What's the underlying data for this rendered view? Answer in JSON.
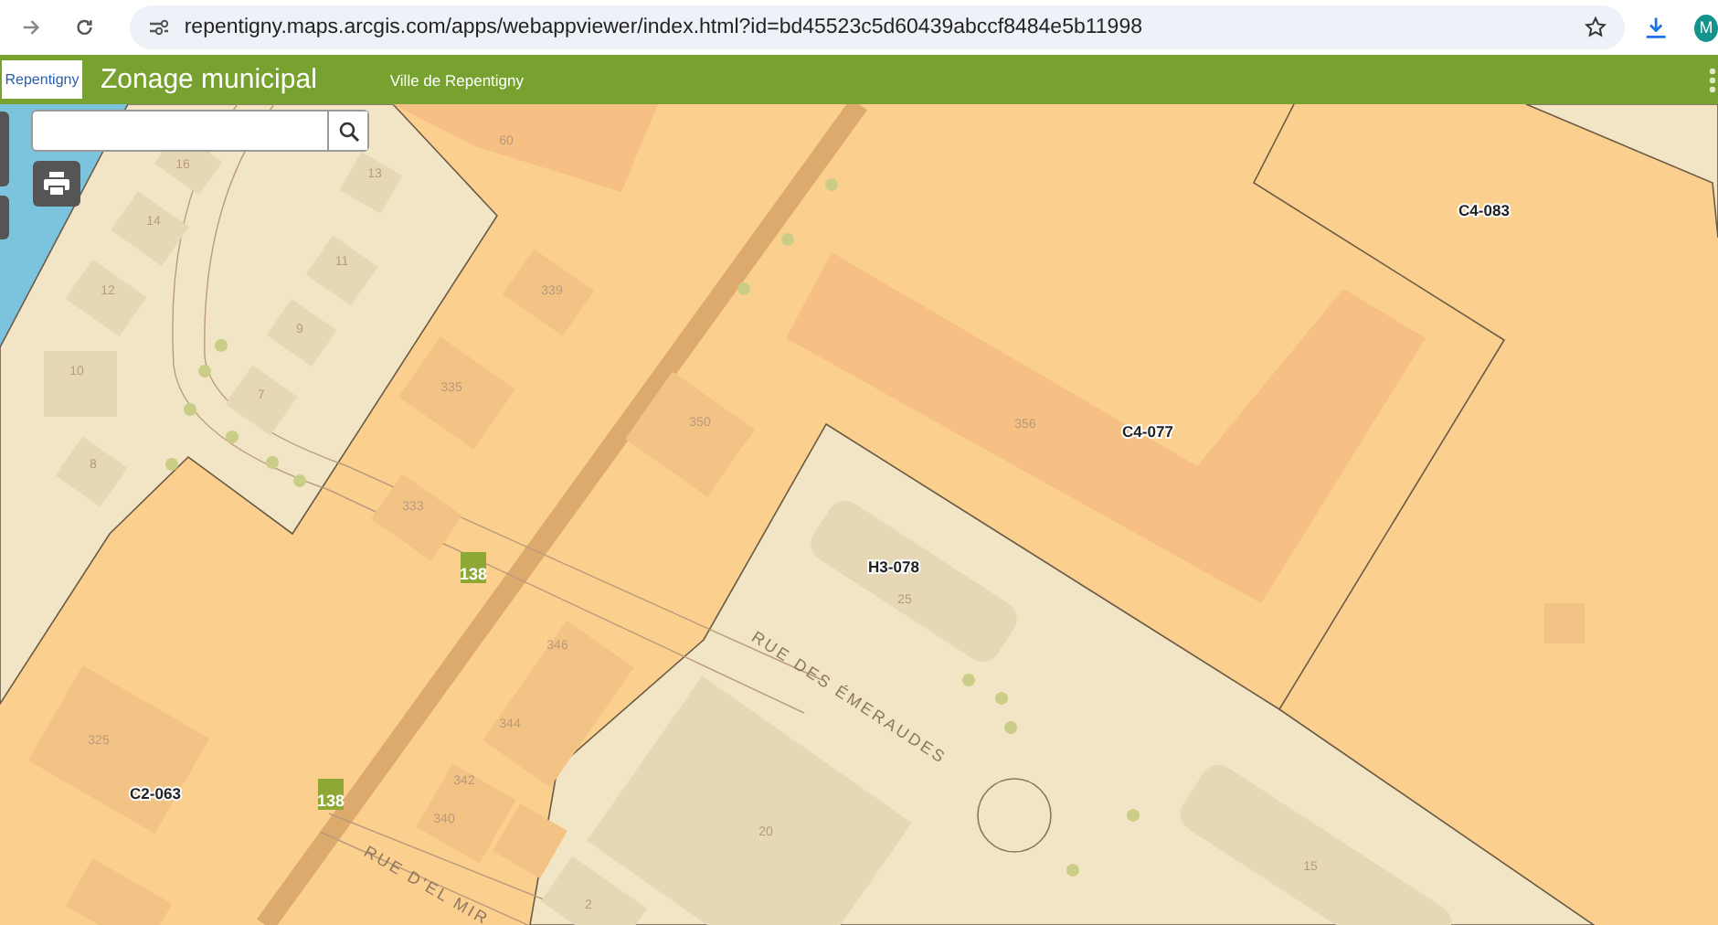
{
  "browser": {
    "url": "repentigny.maps.arcgis.com/apps/webappviewer/index.html?id=bd45523c5d60439abccf8484e5b11998",
    "avatar": "M"
  },
  "header": {
    "logo": "Repentigny",
    "title": "Zonage municipal",
    "subtitle": "Ville de Repentigny"
  },
  "map": {
    "zone_labels": [
      "C4-083",
      "C4-077",
      "H3-078",
      "C2-063"
    ],
    "street_labels": [
      "RUE DES ÉMERAUDES",
      "RUE D'EL MIR"
    ],
    "route_shields": [
      "138",
      "138"
    ],
    "address_numbers": [
      "60",
      "16",
      "13",
      "14",
      "11",
      "12",
      "339",
      "9",
      "10",
      "335",
      "350",
      "356",
      "7",
      "8",
      "333",
      "25",
      "346",
      "344",
      "325",
      "342",
      "340",
      "20",
      "15",
      "2"
    ]
  }
}
